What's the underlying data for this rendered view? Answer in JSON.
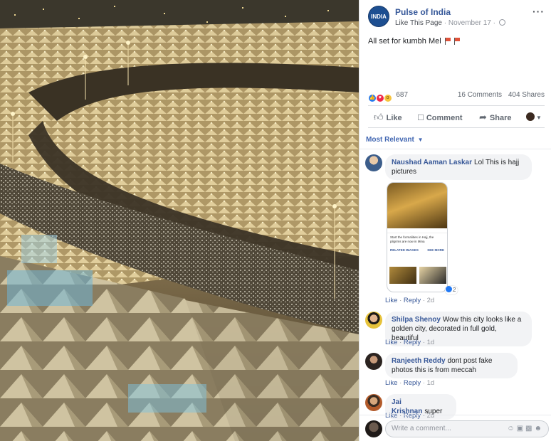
{
  "page": {
    "name": "Pulse of India",
    "avatar_text": "INDIA",
    "like_link": "Like This Page",
    "date": "November 17"
  },
  "post": {
    "text": "All set for kumbh Mel"
  },
  "stats": {
    "reactions": "687",
    "comments": "16 Comments",
    "shares": "404 Shares"
  },
  "actions": {
    "like": "Like",
    "comment": "Comment",
    "share": "Share"
  },
  "sort": {
    "label": "Most Relevant"
  },
  "comments": [
    {
      "author": "Naushad Aaman Laskar",
      "text": "Lol This is hajj pictures",
      "like": "Like",
      "reply": "Reply",
      "time": "2d",
      "attachment": {
        "headline": "Start the formalities in Hajj, the pilgrims are now in Mina",
        "section": "RELATED IMAGES",
        "see_more": "SEE MORE",
        "reactions": "2"
      }
    },
    {
      "author": "Shilpa Shenoy",
      "text": "Wow this city looks like a golden city, decorated in full gold, beautiful",
      "like": "Like",
      "reply": "Reply",
      "time": "1d"
    },
    {
      "author": "Ranjeeth Reddy",
      "text": "dont post fake photos this is from meccah",
      "like": "Like",
      "reply": "Reply",
      "time": "1d"
    },
    {
      "author": "Jai Krishnan",
      "text": "super",
      "like": "Like",
      "reply": "Reply",
      "time": "2d"
    }
  ],
  "composer": {
    "placeholder": "Write a comment..."
  },
  "colors": {
    "link": "#365899",
    "like_blue": "#2078f4",
    "bubble": "#f2f3f5"
  }
}
